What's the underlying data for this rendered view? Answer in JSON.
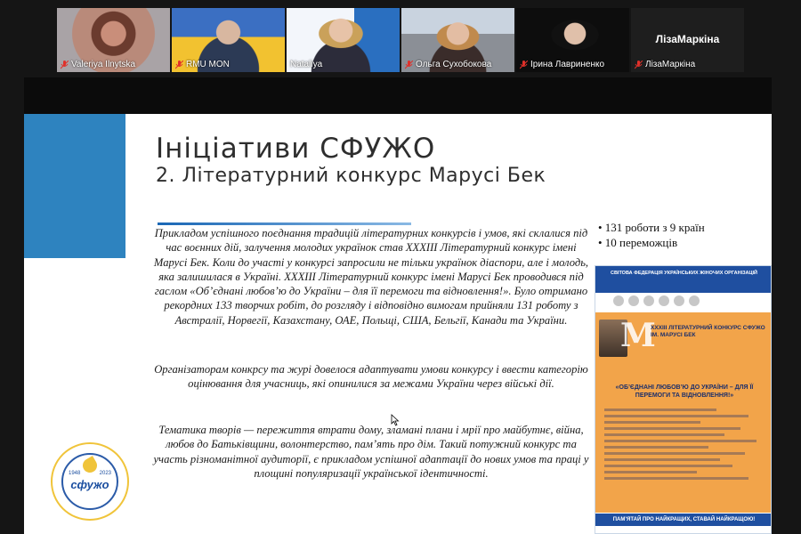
{
  "participants": [
    {
      "name": "Valeriya Ilnytska",
      "muted": true
    },
    {
      "name": "RMU MON",
      "muted": true
    },
    {
      "name": "Nataliya",
      "muted": false,
      "speaking": true
    },
    {
      "name": "Ольга Сухобокова",
      "muted": true
    },
    {
      "name": "Ірина Лавриненко",
      "muted": true
    },
    {
      "name": "ЛізаМаркіна",
      "muted": true,
      "no_video": true
    }
  ],
  "slide": {
    "title": "Ініціативи СФУЖО",
    "subtitle": "2. Літературний конкурс Марусі Бек",
    "paragraph1": "Прикладом успішного поєднання традицій літературних конкурсів і умов, які склалися під час воєнних дій, залучення молодих українок став ХХХІІІ Літературний конкурс імені Марусі Бек. Коли до участі у конкурсі запросили не тільки українок діаспори, але і молодь, яка залишилася в Україні. ХХХІІІ Літературний конкурс імені Марусі Бек проводився під гаслом «Об’єднані любов’ю до України – для її перемоги та відновлення!». Було отримано рекордних 133 творчих робіт, до розгляду і відповідно вимогам прийняли 131 роботу з Австралії, Норвегії, Казахстану, ОАЕ, Польщі, США, Бельгії, Канади та України.",
    "paragraph2": "Організаторам конкрсу та журі довелося адаптувати умови конкурсу і ввести категорію оцінювання для учасниць, які опинилися за межами України через війські дії.",
    "paragraph3": "Тематика творів — пережиття втрати дому, зламані плани і мрії про майбутнє, війна, любов до Батьківщини, волонтерство, пам’ять про дім. Такий потужний конкурс та участь різноманітної аудиторії, є прикладом успішної адаптації до нових умов та праці у площині популяризації української ідентичності.",
    "stats": [
      "• 131 роботи з 9 країн",
      "• 10 переможців"
    ],
    "poster": {
      "header": "СВІТОВА ФЕДЕРАЦІЯ УКРАЇНСЬКИХ ЖІНОЧИХ ОРГАНІЗАЦІЙ",
      "title": "ХХХІІІ ЛІТЕРАТУРНИЙ КОНКУРС СФУЖО ІМ. МАРУСІ БЕК",
      "motto": "«ОБ’ЄДНАНІ ЛЮБОВ’Ю ДО УКРАЇНИ – ДЛЯ ЇЇ ПЕРЕМОГИ ТА ВІДНОВЛЕННЯ!»",
      "footer": "ПАМ’ЯТАЙ ПРО НАЙКРАЩИХ, СТАВАЙ НАЙКРАЩОЮ!"
    },
    "logo": {
      "brand": "сфужо",
      "year_start": "1948",
      "year_end": "2023"
    }
  },
  "colors": {
    "speaking_outline": "#23d14b",
    "muted_icon": "#e0302a",
    "slide_accent": "#2e83bf"
  }
}
